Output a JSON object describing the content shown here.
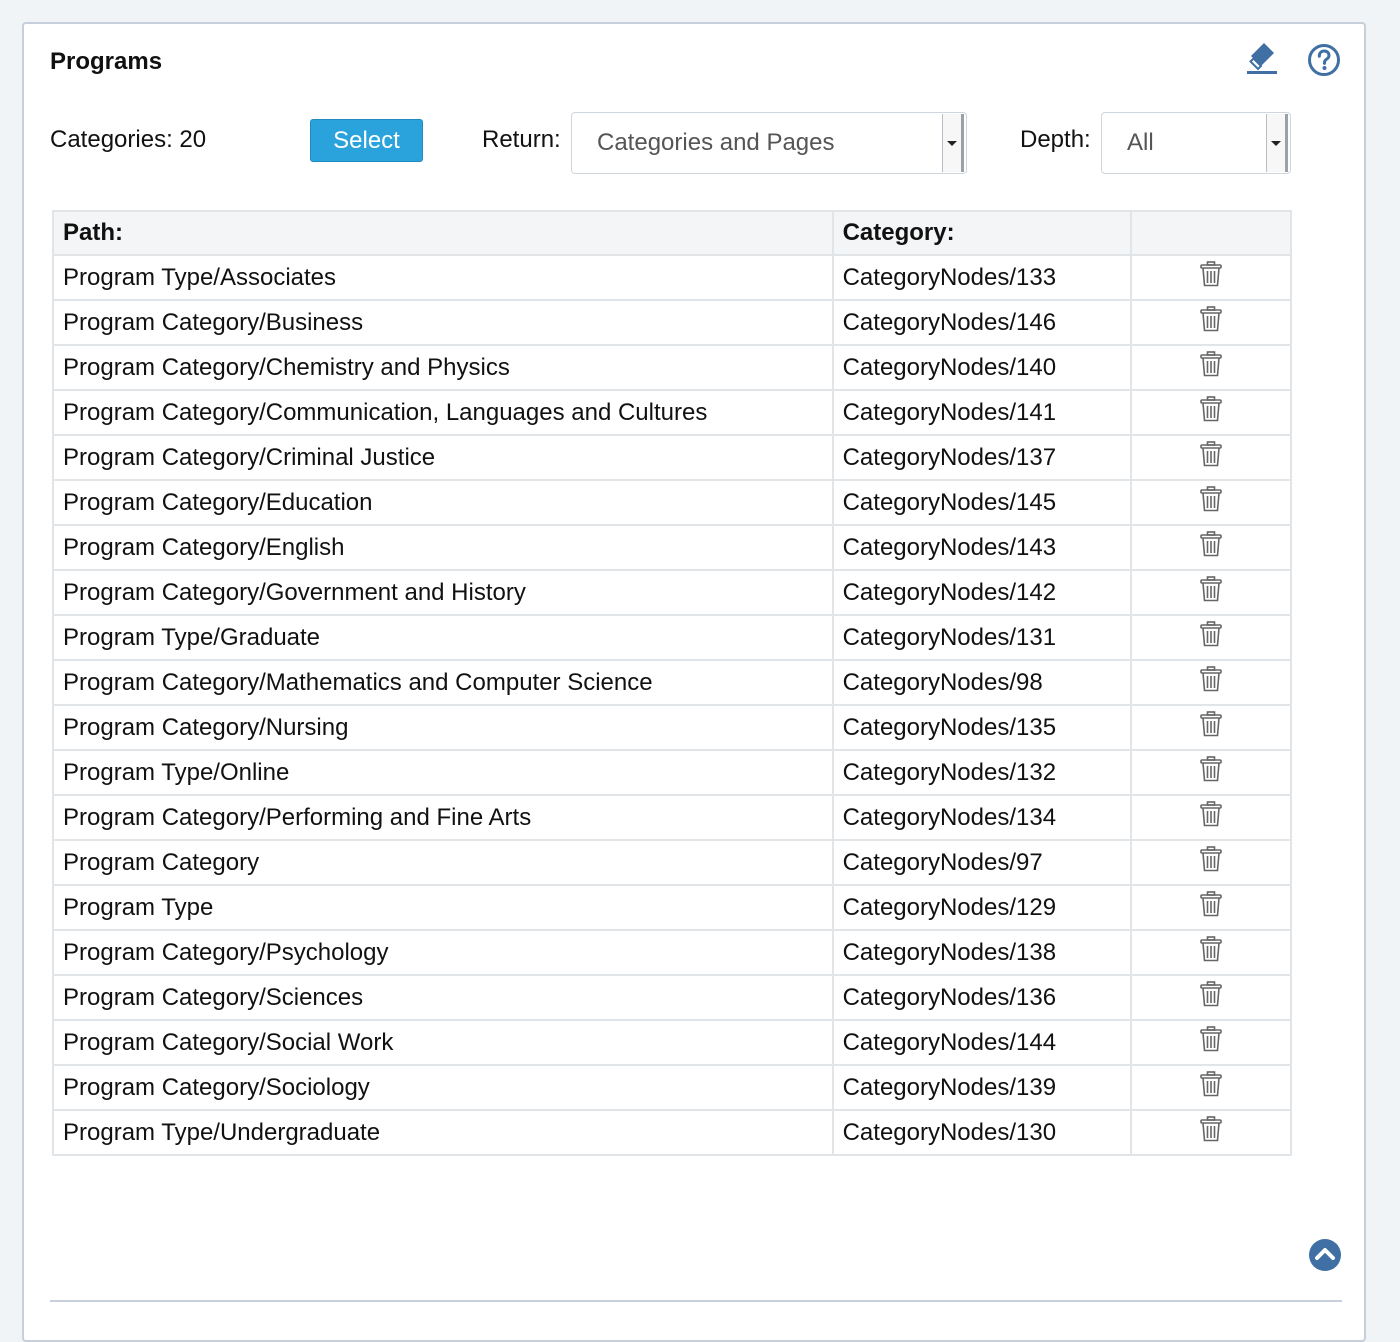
{
  "panel": {
    "title": "Programs",
    "icons": [
      "eraser-icon",
      "help-circle-icon"
    ]
  },
  "toolbar": {
    "categories_count": "Categories: 20",
    "select_label": "Select",
    "return_label": "Return:",
    "return_value": "Categories and Pages",
    "depth_label": "Depth:",
    "depth_value": "All"
  },
  "table": {
    "headers": {
      "path": "Path:",
      "category": "Category:",
      "actions": ""
    },
    "rows": [
      {
        "path": "Program Type/Associates",
        "category": "CategoryNodes/133"
      },
      {
        "path": "Program Category/Business",
        "category": "CategoryNodes/146"
      },
      {
        "path": "Program Category/Chemistry and Physics",
        "category": "CategoryNodes/140"
      },
      {
        "path": "Program Category/Communication, Languages and Cultures",
        "category": "CategoryNodes/141"
      },
      {
        "path": "Program Category/Criminal Justice",
        "category": "CategoryNodes/137"
      },
      {
        "path": "Program Category/Education",
        "category": "CategoryNodes/145"
      },
      {
        "path": "Program Category/English",
        "category": "CategoryNodes/143"
      },
      {
        "path": "Program Category/Government and History",
        "category": "CategoryNodes/142"
      },
      {
        "path": "Program Type/Graduate",
        "category": "CategoryNodes/131"
      },
      {
        "path": "Program Category/Mathematics and Computer Science",
        "category": "CategoryNodes/98"
      },
      {
        "path": "Program Category/Nursing",
        "category": "CategoryNodes/135"
      },
      {
        "path": "Program Type/Online",
        "category": "CategoryNodes/132"
      },
      {
        "path": "Program Category/Performing and Fine Arts",
        "category": "CategoryNodes/134"
      },
      {
        "path": "Program Category",
        "category": "CategoryNodes/97"
      },
      {
        "path": "Program Type",
        "category": "CategoryNodes/129"
      },
      {
        "path": "Program Category/Psychology",
        "category": "CategoryNodes/138"
      },
      {
        "path": "Program Category/Sciences",
        "category": "CategoryNodes/136"
      },
      {
        "path": "Program Category/Social Work",
        "category": "CategoryNodes/144"
      },
      {
        "path": "Program Category/Sociology",
        "category": "CategoryNodes/139"
      },
      {
        "path": "Program Type/Undergraduate",
        "category": "CategoryNodes/130"
      }
    ],
    "row_action_icon": "trash-icon"
  },
  "footer": {
    "icon": "scroll-top-icon"
  },
  "colors": {
    "accent": "#2aa3dc",
    "icon_blue": "#3f6fa3",
    "border": "#c7d0da"
  }
}
